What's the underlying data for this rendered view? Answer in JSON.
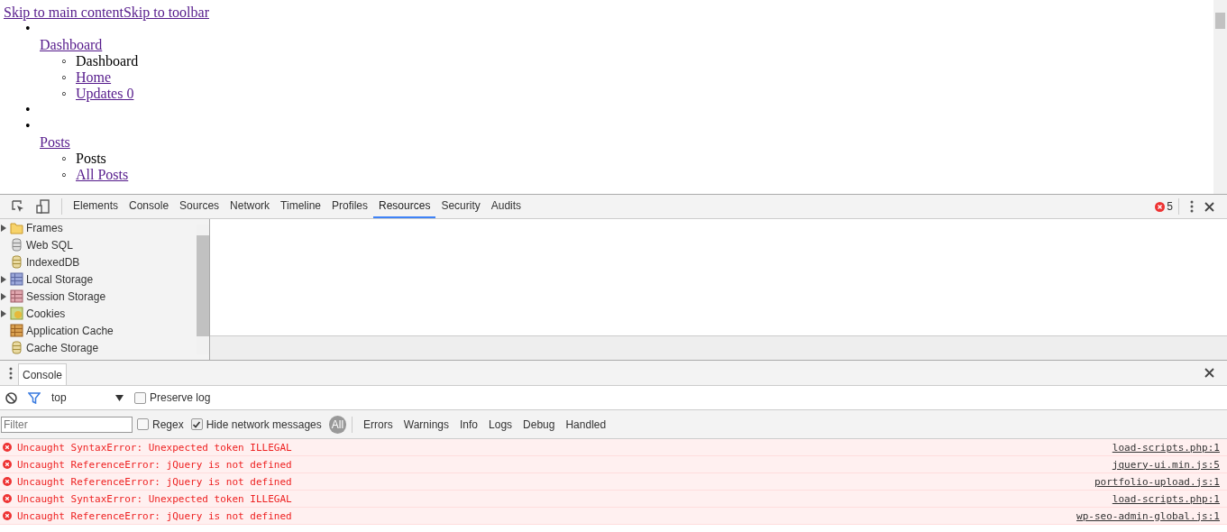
{
  "page": {
    "skip_links": [
      "Skip to main content",
      "Skip to toolbar"
    ],
    "menu": [
      {
        "marker": "•",
        "label": "Dashboard",
        "children": [
          {
            "marker": "◦",
            "label": "Dashboard",
            "kind": "text"
          },
          {
            "marker": "◦",
            "label": "Home",
            "kind": "link"
          },
          {
            "marker": "◦",
            "label": "Updates 0",
            "kind": "link"
          }
        ]
      },
      {
        "marker": "•"
      },
      {
        "marker": "•",
        "label": "Posts",
        "children": [
          {
            "marker": "◦",
            "label": "Posts",
            "kind": "text"
          },
          {
            "marker": "◦",
            "label": "All Posts",
            "kind": "link"
          }
        ]
      }
    ]
  },
  "devtools": {
    "tabs": [
      {
        "label": "Elements",
        "selected": false
      },
      {
        "label": "Console",
        "selected": false
      },
      {
        "label": "Sources",
        "selected": false
      },
      {
        "label": "Network",
        "selected": false
      },
      {
        "label": "Timeline",
        "selected": false
      },
      {
        "label": "Profiles",
        "selected": false
      },
      {
        "label": "Resources",
        "selected": true
      },
      {
        "label": "Security",
        "selected": false
      },
      {
        "label": "Audits",
        "selected": false
      }
    ],
    "error_count": "5",
    "resources": [
      {
        "label": "Frames",
        "kind": "folder",
        "expandable": true
      },
      {
        "label": "Web SQL",
        "kind": "database",
        "expandable": false
      },
      {
        "label": "IndexedDB",
        "kind": "db",
        "expandable": false
      },
      {
        "label": "Local Storage",
        "kind": "localtable",
        "expandable": true
      },
      {
        "label": "Session Storage",
        "kind": "sessiontable",
        "expandable": true
      },
      {
        "label": "Cookies",
        "kind": "cookie",
        "expandable": true
      },
      {
        "label": "Application Cache",
        "kind": "appcache",
        "expandable": false
      },
      {
        "label": "Cache Storage",
        "kind": "db",
        "expandable": false
      }
    ],
    "drawer_tab": "Console",
    "context": "top",
    "preserve_log": {
      "label": "Preserve log",
      "checked": false
    },
    "filter": {
      "placeholder": "Filter"
    },
    "regex": {
      "label": "Regex",
      "checked": false
    },
    "hide_network": {
      "label": "Hide network messages",
      "checked": true
    },
    "levels": [
      {
        "label": "All",
        "selected": true
      },
      {
        "label": "Errors",
        "selected": false
      },
      {
        "label": "Warnings",
        "selected": false
      },
      {
        "label": "Info",
        "selected": false
      },
      {
        "label": "Logs",
        "selected": false
      },
      {
        "label": "Debug",
        "selected": false
      },
      {
        "label": "Handled",
        "selected": false
      }
    ],
    "messages": [
      {
        "text": "Uncaught SyntaxError: Unexpected token ILLEGAL",
        "source": "load-scripts.php:1"
      },
      {
        "text": "Uncaught ReferenceError: jQuery is not defined",
        "source": "jquery-ui.min.js:5"
      },
      {
        "text": "Uncaught ReferenceError: jQuery is not defined",
        "source": "portfolio-upload.js:1"
      },
      {
        "text": "Uncaught SyntaxError: Unexpected token ILLEGAL",
        "source": "load-scripts.php:1"
      },
      {
        "text": "Uncaught ReferenceError: jQuery is not defined",
        "source": "wp-seo-admin-global.js:1"
      }
    ]
  }
}
